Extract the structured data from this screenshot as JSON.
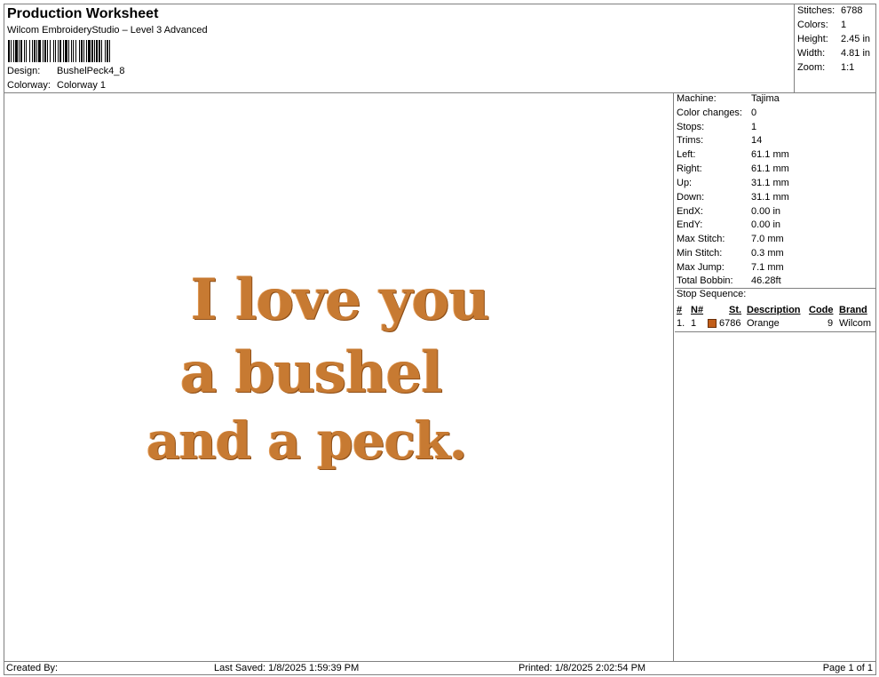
{
  "header": {
    "title": "Production Worksheet",
    "subtitle": "Wilcom EmbroideryStudio – Level 3 Advanced",
    "design_label": "Design:",
    "design_value": "BushelPeck4_8",
    "colorway_label": "Colorway:",
    "colorway_value": "Colorway 1"
  },
  "summary": [
    {
      "label": "Stitches:",
      "value": "6788"
    },
    {
      "label": "Colors:",
      "value": "1"
    },
    {
      "label": "Height:",
      "value": "2.45 in"
    },
    {
      "label": "Width:",
      "value": "4.81 in"
    },
    {
      "label": "Zoom:",
      "value": "1:1"
    }
  ],
  "design": {
    "lines": [
      "I love you",
      "a bushel",
      "and a peck."
    ],
    "thread_color": "#c77a32"
  },
  "machine_info": [
    {
      "label": "Machine:",
      "value": "Tajima"
    },
    {
      "label": "Color changes:",
      "value": "0"
    },
    {
      "label": "Stops:",
      "value": "1"
    },
    {
      "label": "Trims:",
      "value": "14"
    },
    {
      "label": "Left:",
      "value": "61.1 mm"
    },
    {
      "label": "Right:",
      "value": "61.1 mm"
    },
    {
      "label": "Up:",
      "value": "31.1 mm"
    },
    {
      "label": "Down:",
      "value": "31.1 mm"
    },
    {
      "label": "EndX:",
      "value": "0.00 in"
    },
    {
      "label": "EndY:",
      "value": "0.00 in"
    },
    {
      "label": "Max Stitch:",
      "value": "7.0 mm"
    },
    {
      "label": "Min Stitch:",
      "value": "0.3 mm"
    },
    {
      "label": "Max Jump:",
      "value": "7.1 mm"
    },
    {
      "label": "Total Bobbin:",
      "value": "46.28ft"
    }
  ],
  "stop_sequence": {
    "title": "Stop Sequence:",
    "headers": {
      "num": "#",
      "needle": "N#",
      "stitches": "St.",
      "description": "Description",
      "code": "Code",
      "brand": "Brand"
    },
    "rows": [
      {
        "num": "1.",
        "needle": "1",
        "swatch_color": "#c25e1a",
        "stitches": "6786",
        "description": "Orange",
        "code": "9",
        "brand": "Wilcom"
      }
    ]
  },
  "footer": {
    "created_by": "Created By:",
    "last_saved": "Last Saved: 1/8/2025 1:59:39 PM",
    "printed": "Printed: 1/8/2025 2:02:54 PM",
    "page": "Page 1 of 1"
  }
}
